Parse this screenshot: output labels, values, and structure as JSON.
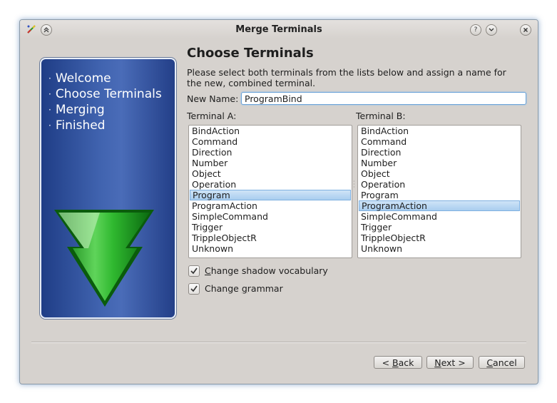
{
  "window": {
    "title": "Merge Terminals"
  },
  "sidebar": {
    "steps": [
      "Welcome",
      "Choose Terminals",
      "Merging",
      "Finished"
    ]
  },
  "page": {
    "heading": "Choose Terminals",
    "description": "Please select both terminals from the lists below and assign a name for the new, combined terminal.",
    "new_name_label": "New Name:",
    "new_name_value": "ProgramBind",
    "terminal_a_label": "Terminal A:",
    "terminal_b_label": "Terminal B:"
  },
  "terminal_a": {
    "items": [
      "BindAction",
      "Command",
      "Direction",
      "Number",
      "Object",
      "Operation",
      "Program",
      "ProgramAction",
      "SimpleCommand",
      "Trigger",
      "TrippleObjectR",
      "Unknown"
    ],
    "selected": "Program"
  },
  "terminal_b": {
    "items": [
      "BindAction",
      "Command",
      "Direction",
      "Number",
      "Object",
      "Operation",
      "Program",
      "ProgramAction",
      "SimpleCommand",
      "Trigger",
      "TrippleObjectR",
      "Unknown"
    ],
    "selected": "ProgramAction"
  },
  "options": {
    "shadow_vocab": {
      "label_pre": "",
      "label_ul": "C",
      "label_post": "hange shadow vocabulary",
      "checked": true
    },
    "grammar": {
      "label_pre": "Change ",
      "label_ul": "g",
      "label_post": "rammar",
      "checked": true
    }
  },
  "buttons": {
    "back_pre": "< ",
    "back_ul": "B",
    "back_post": "ack",
    "next_pre": "",
    "next_ul": "N",
    "next_post": "ext >",
    "cancel_pre": "",
    "cancel_ul": "C",
    "cancel_post": "ancel"
  },
  "icons": {
    "app": "pencil-icon",
    "shade": "shade-icon",
    "help": "help-icon",
    "minimize": "minimize-icon",
    "close": "close-icon",
    "step_arrow": "down-arrow-icon",
    "check": "check-icon"
  },
  "colors": {
    "accent": "#4a6cb8",
    "selection": "#a9cdef",
    "arrow_green": "#2fb82f",
    "window_bg": "#d6d2ce"
  }
}
